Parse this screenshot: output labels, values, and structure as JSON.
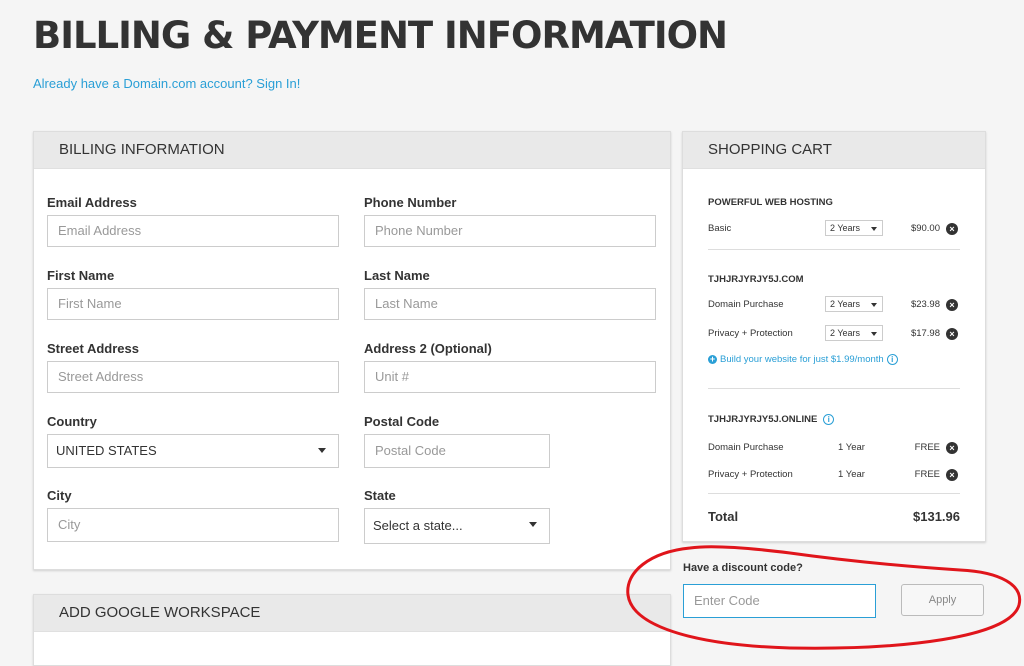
{
  "page": {
    "title": "BILLING & PAYMENT INFORMATION",
    "signin_text": "Already have a Domain.com account? Sign In!"
  },
  "billing": {
    "header": "BILLING INFORMATION",
    "fields": {
      "email": {
        "label": "Email Address",
        "placeholder": "Email Address"
      },
      "phone": {
        "label": "Phone Number",
        "placeholder": "Phone Number"
      },
      "first_name": {
        "label": "First Name",
        "placeholder": "First Name"
      },
      "last_name": {
        "label": "Last Name",
        "placeholder": "Last Name"
      },
      "street": {
        "label": "Street Address",
        "placeholder": "Street Address"
      },
      "address2": {
        "label": "Address 2 (Optional)",
        "placeholder": "Unit #"
      },
      "country": {
        "label": "Country",
        "value": "UNITED STATES"
      },
      "postal": {
        "label": "Postal Code",
        "placeholder": "Postal Code"
      },
      "city": {
        "label": "City",
        "placeholder": "City"
      },
      "state": {
        "label": "State",
        "value": "Select a state..."
      }
    }
  },
  "workspace": {
    "header": "ADD GOOGLE WORKSPACE"
  },
  "cart": {
    "header": "SHOPPING CART",
    "sections": [
      {
        "title": "POWERFUL WEB HOSTING",
        "items": [
          {
            "name": "Basic",
            "term": "2 Years",
            "price": "$90.00"
          }
        ]
      },
      {
        "title": "TJHJRJYRJY5J.COM",
        "items": [
          {
            "name": "Domain Purchase",
            "term": "2 Years",
            "price": "$23.98"
          },
          {
            "name": "Privacy + Protection",
            "term": "2 Years",
            "price": "$17.98"
          }
        ],
        "link": "Build your website for just $1.99/month"
      },
      {
        "title": "TJHJRJYRJY5J.ONLINE",
        "items": [
          {
            "name": "Domain Purchase",
            "term": "1 Year",
            "price": "FREE"
          },
          {
            "name": "Privacy + Protection",
            "term": "1 Year",
            "price": "FREE"
          }
        ]
      }
    ],
    "total_label": "Total",
    "total_value": "$131.96",
    "remove_glyph": "×",
    "info_glyph": "i",
    "plus_glyph": "+"
  },
  "discount": {
    "label": "Have a discount code?",
    "placeholder": "Enter Code",
    "apply_label": "Apply"
  },
  "colors": {
    "link": "#2a9fd6",
    "annotation": "#e0151b"
  }
}
